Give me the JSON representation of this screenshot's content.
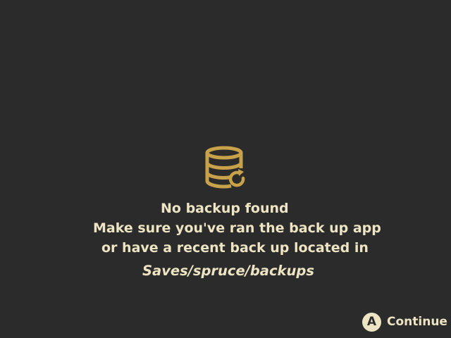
{
  "icon": "database-restore-icon",
  "message": {
    "line1": "No backup found",
    "line2": "Make sure you've ran the back up app",
    "line3": "or have a recent back up located in",
    "path": "Saves/spruce/backups"
  },
  "footer": {
    "button_glyph": "A",
    "continue_label": "Continue"
  },
  "colors": {
    "background": "#2b2b2b",
    "icon": "#c8a24a",
    "text": "#ece4c2"
  }
}
